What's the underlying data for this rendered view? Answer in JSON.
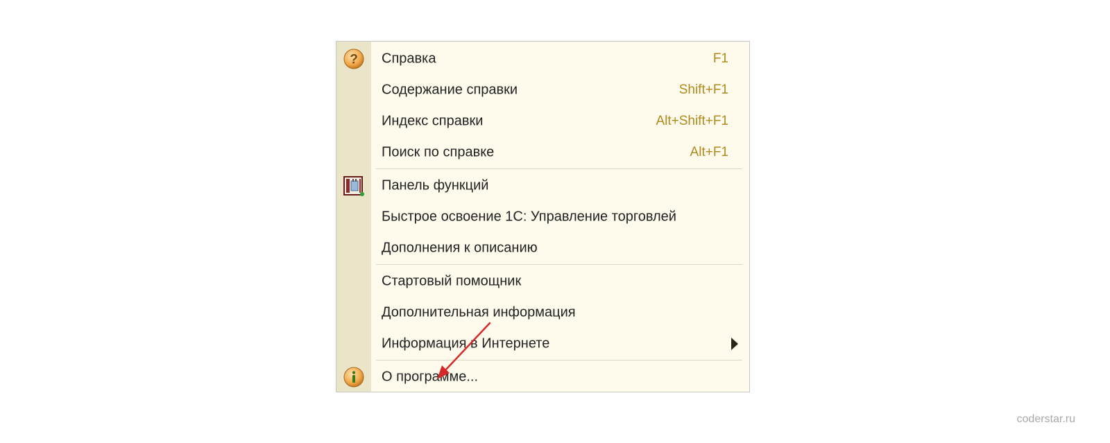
{
  "menu": {
    "items": [
      {
        "label": "Справка",
        "shortcut": "F1",
        "icon": "help-icon"
      },
      {
        "label": "Содержание справки",
        "shortcut": "Shift+F1"
      },
      {
        "label": "Индекс справки",
        "shortcut": "Alt+Shift+F1"
      },
      {
        "label": "Поиск по справке",
        "shortcut": "Alt+F1"
      },
      {
        "label": "Панель функций",
        "icon": "function-panel-icon"
      },
      {
        "label": "Быстрое освоение 1С: Управление торговлей"
      },
      {
        "label": "Дополнения к описанию"
      },
      {
        "label": "Стартовый помощник"
      },
      {
        "label": "Дополнительная информация"
      },
      {
        "label": "Информация в Интернете",
        "submenu": true
      },
      {
        "label": "О программе...",
        "icon": "info-icon"
      }
    ]
  },
  "watermark": "coderstar.ru",
  "colors": {
    "menu_background": "#fefaec",
    "gutter": "#eae4c8",
    "shortcut_text": "#b08a1e",
    "annotation_arrow": "#d42a2a"
  }
}
